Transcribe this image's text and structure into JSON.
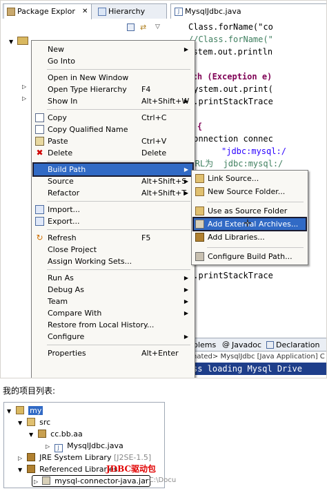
{
  "eclipse": {
    "tabs": {
      "package_explorer": "Package Explor",
      "hierarchy": "Hierarchy",
      "editor": "MysqlJdbc.java"
    },
    "editor_lines": [
      {
        "cls": "",
        "text": "Class.forName(\"co"
      },
      {
        "cls": "cm",
        "text": "//Class.forName(\""
      },
      {
        "cls": "",
        "text": "System.out.println"
      },
      {
        "cls": "",
        "text": "}"
      },
      {
        "cls": "kw",
        "text": "catch (Exception e)"
      },
      {
        "cls": "",
        "text": "System.out.print("
      },
      {
        "cls": "",
        "text": "e.printStackTrace"
      },
      {
        "cls": "",
        "text": "}"
      },
      {
        "cls": "kw",
        "text": "try {"
      },
      {
        "cls": "",
        "text": "Connection connec"
      },
      {
        "cls": "st",
        "text": "\"jdbc:mysql:/"
      },
      {
        "cls": "cm",
        "text": "//连接URL为  jdbc:mysql:/"
      },
      {
        "cls": "cm",
        "text": "//后面的2个参数分别是登陆"
      },
      {
        "cls": "",
        "text": ""
      },
      {
        "cls": "",
        "text": ""
      },
      {
        "cls": "",
        "text": ""
      },
      {
        "cls": "",
        "text": ""
      },
      {
        "cls": "",
        "text": ""
      },
      {
        "cls": "",
        "text": ""
      },
      {
        "cls": "",
        "text": ""
      },
      {
        "cls": "",
        "text": "e.printStackTrace"
      },
      {
        "cls": "",
        "text": "}"
      },
      {
        "cls": "",
        "text": "}"
      }
    ],
    "context_menu": [
      {
        "label": "New",
        "accel": "",
        "submenu": true
      },
      {
        "label": "Go Into",
        "accel": "",
        "submenu": false
      },
      {
        "sep": true
      },
      {
        "label": "Open in New Window",
        "accel": "",
        "submenu": false
      },
      {
        "label": "Open Type Hierarchy",
        "accel": "F4",
        "submenu": false
      },
      {
        "label": "Show In",
        "accel": "Alt+Shift+W",
        "submenu": true
      },
      {
        "sep": true
      },
      {
        "label": "Copy",
        "accel": "Ctrl+C",
        "submenu": false,
        "icon": "copy-icon"
      },
      {
        "label": "Copy Qualified Name",
        "accel": "",
        "submenu": false,
        "icon": "copy-icon"
      },
      {
        "label": "Paste",
        "accel": "Ctrl+V",
        "submenu": false,
        "icon": "paste-icon"
      },
      {
        "label": "Delete",
        "accel": "Delete",
        "submenu": false,
        "icon": "delete-icon"
      },
      {
        "sep": true
      },
      {
        "label": "Build Path",
        "accel": "",
        "submenu": true,
        "selected": true
      },
      {
        "label": "Source",
        "accel": "Alt+Shift+S",
        "submenu": true
      },
      {
        "label": "Refactor",
        "accel": "Alt+Shift+T",
        "submenu": true
      },
      {
        "sep": true
      },
      {
        "label": "Import...",
        "accel": "",
        "submenu": false,
        "icon": "import-icon"
      },
      {
        "label": "Export...",
        "accel": "",
        "submenu": false,
        "icon": "export-icon"
      },
      {
        "sep": true
      },
      {
        "label": "Refresh",
        "accel": "F5",
        "submenu": false,
        "icon": "refresh-icon"
      },
      {
        "label": "Close Project",
        "accel": "",
        "submenu": false
      },
      {
        "label": "Assign Working Sets...",
        "accel": "",
        "submenu": false
      },
      {
        "sep": true
      },
      {
        "label": "Run As",
        "accel": "",
        "submenu": true
      },
      {
        "label": "Debug As",
        "accel": "",
        "submenu": true
      },
      {
        "label": "Team",
        "accel": "",
        "submenu": true
      },
      {
        "label": "Compare With",
        "accel": "",
        "submenu": true
      },
      {
        "label": "Restore from Local History...",
        "accel": "",
        "submenu": false
      },
      {
        "label": "Configure",
        "accel": "",
        "submenu": true
      },
      {
        "sep": true
      },
      {
        "label": "Properties",
        "accel": "Alt+Enter",
        "submenu": false
      }
    ],
    "submenu": [
      {
        "label": "Link Source...",
        "icon": "link-source-icon"
      },
      {
        "label": "New Source Folder...",
        "icon": "folder-icon"
      },
      {
        "sep": true
      },
      {
        "label": "Use as Source Folder",
        "icon": "folder-icon"
      },
      {
        "label": "Add External Archives...",
        "icon": "jar-icon",
        "selected": true
      },
      {
        "label": "Add Libraries...",
        "icon": "library-icon"
      },
      {
        "sep": true
      },
      {
        "label": "Configure Build Path...",
        "icon": "config-icon"
      }
    ],
    "bottom_tabs": [
      "blems",
      "Javadoc",
      "Declaration"
    ],
    "console_header": "nated> MysqlJdbc [Java Application] C",
    "console_line": "ss loading Mysql Drive"
  },
  "caption": "我的项目列表:",
  "project_tree": {
    "root": "my",
    "src": "src",
    "package": "cc.bb.aa",
    "file": "MysqlJdbc.java",
    "jre_label": "JRE System Library",
    "jre_version": "[J2SE-1.5]",
    "ref_libs": "Referenced Libraries",
    "jar_label": "mysql-connector-java.jar",
    "jar_path": "- C:\\Docu",
    "annotation": "JDBC驱动包"
  }
}
